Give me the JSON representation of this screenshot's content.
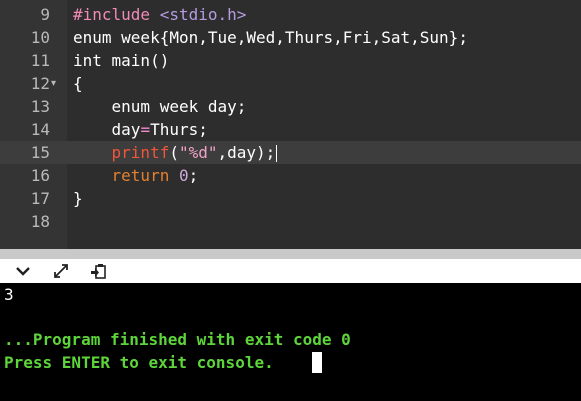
{
  "editor": {
    "lines": [
      {
        "num": "9",
        "fold": "",
        "parts": [
          {
            "t": "#include ",
            "c": "tok-pre"
          },
          {
            "t": "<stdio.h>",
            "c": "tok-inc"
          }
        ]
      },
      {
        "num": "10",
        "fold": "",
        "parts": [
          {
            "t": "enum week{Mon,Tue,Wed,Thurs,Fri,Sat,Sun};",
            "c": ""
          }
        ]
      },
      {
        "num": "11",
        "fold": "",
        "parts": [
          {
            "t": "int main()",
            "c": ""
          }
        ]
      },
      {
        "num": "12",
        "fold": "▾",
        "parts": [
          {
            "t": "{",
            "c": ""
          }
        ]
      },
      {
        "num": "13",
        "fold": "",
        "parts": [
          {
            "t": "    enum week day;",
            "c": ""
          }
        ]
      },
      {
        "num": "14",
        "fold": "",
        "parts": [
          {
            "t": "    day",
            "c": ""
          },
          {
            "t": "=",
            "c": "tok-op"
          },
          {
            "t": "Thurs;",
            "c": ""
          }
        ]
      },
      {
        "num": "15",
        "fold": "",
        "active": true,
        "cursor": true,
        "parts": [
          {
            "t": "    printf",
            "c": "tok-fn"
          },
          {
            "t": "(",
            "c": ""
          },
          {
            "t": "\"%d\"",
            "c": "tok-str"
          },
          {
            "t": ",day);",
            "c": ""
          }
        ]
      },
      {
        "num": "16",
        "fold": "",
        "parts": [
          {
            "t": "    return ",
            "c": "tok-kw"
          },
          {
            "t": "0",
            "c": "tok-num"
          },
          {
            "t": ";",
            "c": ""
          }
        ]
      },
      {
        "num": "17",
        "fold": "",
        "parts": [
          {
            "t": "}",
            "c": ""
          }
        ]
      },
      {
        "num": "18",
        "fold": "",
        "parts": []
      }
    ]
  },
  "toolbar": {
    "icons": [
      "chevron-down-icon",
      "expand-icon",
      "paste-icon"
    ]
  },
  "console": {
    "result": "3",
    "finished": "...Program finished with exit code 0",
    "prompt": "Press ENTER to exit console."
  },
  "colors": {
    "editor_bg": "#2d2d2d",
    "gutter_bg": "#343434",
    "console_bg": "#000000",
    "console_green": "#5dd53a"
  }
}
